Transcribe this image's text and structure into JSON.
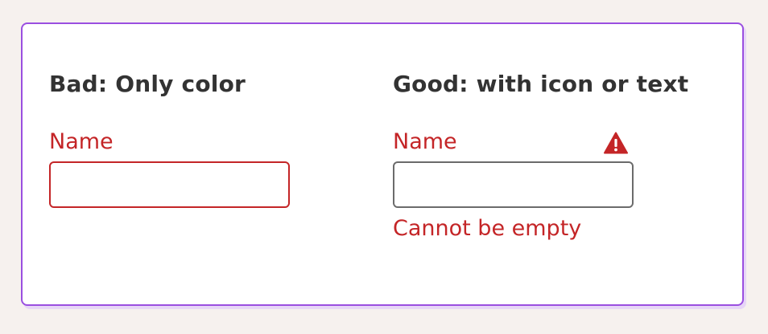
{
  "bad_example": {
    "heading": "Bad: Only color",
    "field_label": "Name",
    "input_value": ""
  },
  "good_example": {
    "heading": "Good: with icon or text",
    "field_label": "Name",
    "input_value": "",
    "icon": "warning-triangle",
    "error_message": "Cannot be empty"
  },
  "colors": {
    "error": "#c42527",
    "card_border": "#9a4fe0",
    "heading_text": "#333333",
    "neutral_border": "#6b6b6b",
    "background": "#f6f1ee"
  }
}
